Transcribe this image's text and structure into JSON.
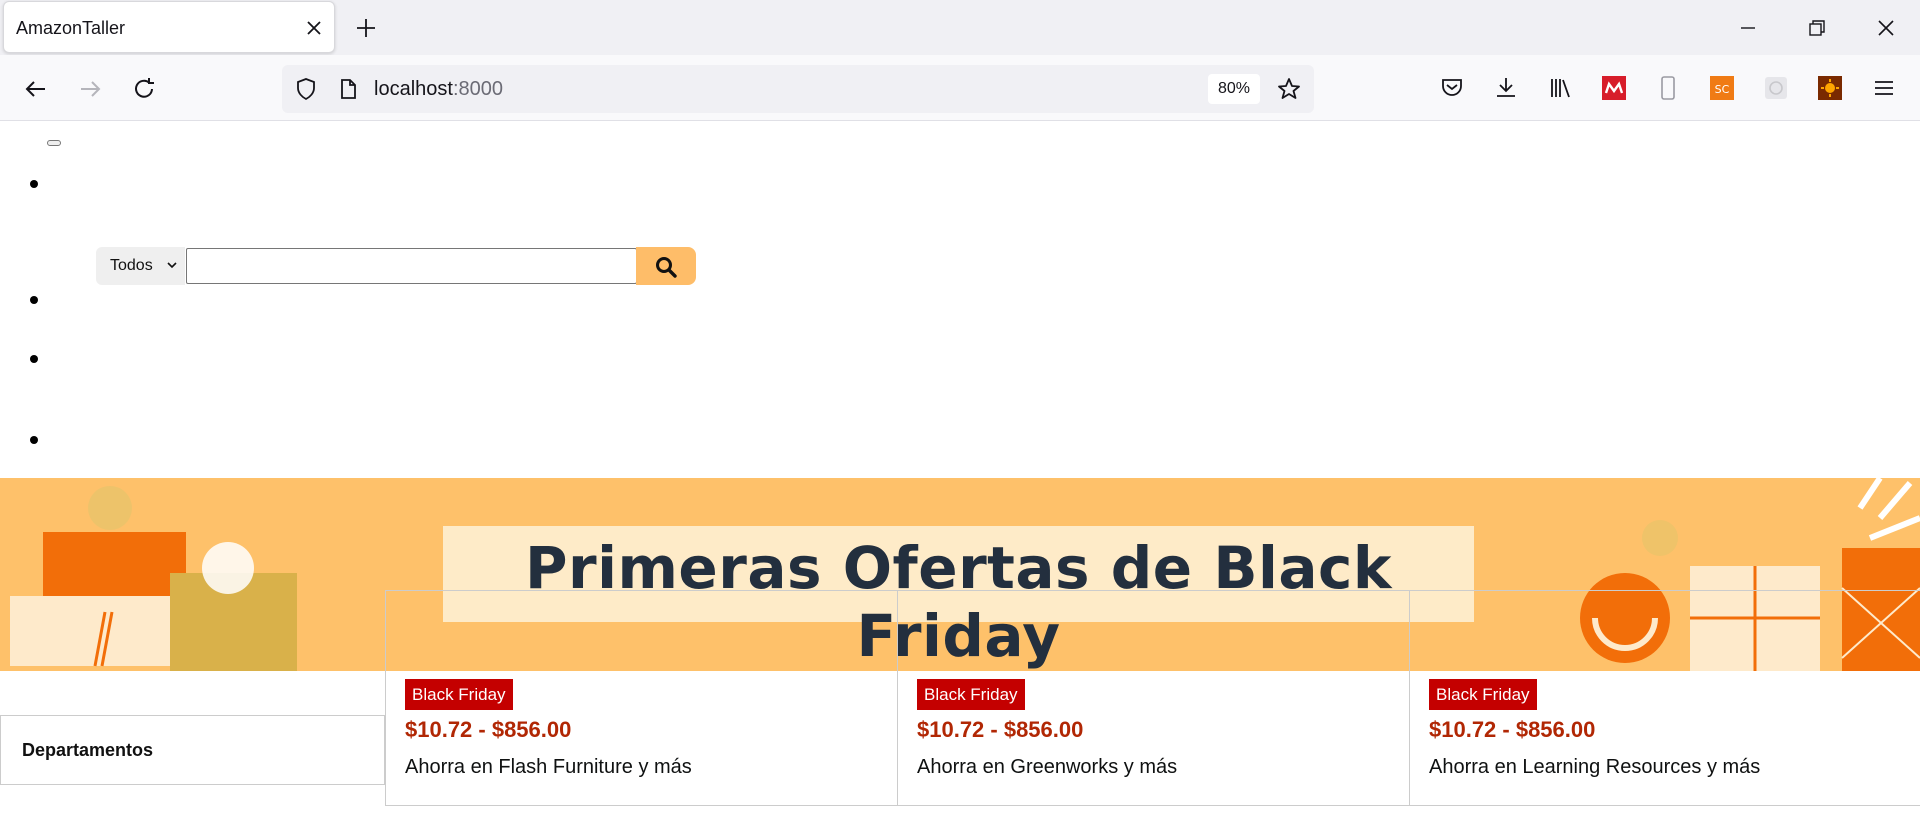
{
  "browser": {
    "tab_title": "AmazonTaller",
    "url_host": "localhost",
    "url_port": ":8000",
    "zoom": "80%"
  },
  "search": {
    "category_selected": "Todos",
    "placeholder": ""
  },
  "banner": {
    "title": "Primeras Ofertas de Black Friday",
    "colors": {
      "background": "#fec16a",
      "title_box": "#feebc8",
      "title_text": "#232f3e"
    }
  },
  "sidebar": {
    "departments_label": "Departamentos"
  },
  "deals": [
    {
      "badge": "Black Friday",
      "price": "$10.72 - $856.00",
      "description": "Ahorra en Flash Furniture y más"
    },
    {
      "badge": "Black Friday",
      "price": "$10.72 - $856.00",
      "description": "Ahorra en Greenworks y más"
    },
    {
      "badge": "Black Friday",
      "price": "$10.72 - $856.00",
      "description": "Ahorra en Learning Resources y más"
    }
  ]
}
